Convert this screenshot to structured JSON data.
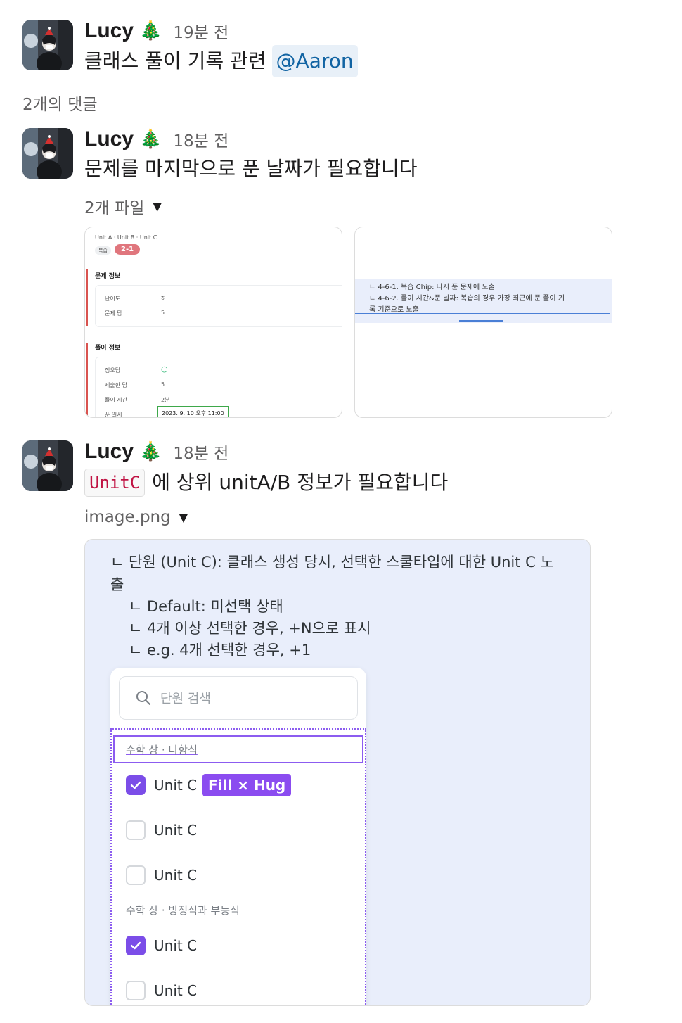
{
  "messages": [
    {
      "author": "Lucy",
      "emoji": "🎄",
      "time": "19분 전",
      "text": "클래스 풀이 기록 관련",
      "mention": "@Aaron"
    },
    {
      "author": "Lucy",
      "emoji": "🎄",
      "time": "18분 전",
      "text": "문제를 마지막으로 푼 날짜가 필요합니다",
      "files_label": "2개 파일"
    },
    {
      "author": "Lucy",
      "emoji": "🎄",
      "time": "18분 전",
      "code": "UnitC",
      "text": "에 상위 unitA/B 정보가 필요합니다",
      "file_name": "image.png"
    }
  ],
  "thread": {
    "replies_label": "2개의 댓글"
  },
  "thumb1": {
    "breadcrumb": "Unit A · Unit B · Unit C",
    "tag": "복습",
    "badge": "2-1",
    "section1": "문제 정보",
    "difficulty_label": "난이도",
    "difficulty_value": "하",
    "answer_label": "문제 답",
    "answer_value": "5",
    "section2": "풀이 정보",
    "correct_label": "정오답",
    "correct_value": "○",
    "submitted_label": "제출한 답",
    "submitted_value": "5",
    "time_label": "풀이 시간",
    "time_value": "2분",
    "date_label": "푼 일시",
    "date_value": "2023. 9. 10 오후 11:00"
  },
  "thumb2": {
    "line1": "ㄴ 4-6-1. 복습 Chip: 다시 푼 문제에 노출",
    "line2": "ㄴ 4-6-2. 풀이 시간&푼 날짜: 복습의 경우 가장 최근에 푼 풀이 기",
    "line3": "록 기준으로 노출"
  },
  "image": {
    "line1": "ㄴ 단원 (Unit C): 클래스 생성 당시, 선택한 스쿨타입에 대한 Unit C 노",
    "line2": "출",
    "line3": "ㄴ Default: 미선택 상태",
    "line4": "ㄴ 4개 이상 선택한 경우, +N으로 표시",
    "line5": "ㄴ e.g. 4개 선택한 경우, +1",
    "search_placeholder": "단원 검색",
    "group1": "수학 상 · 다항식",
    "group2": "수학 상 · 방정식과 부등식",
    "hug_label": "Fill × Hug",
    "items": [
      {
        "label": "Unit C",
        "checked": true
      },
      {
        "label": "Unit C",
        "checked": false
      },
      {
        "label": "Unit C",
        "checked": false
      },
      {
        "label": "Unit C",
        "checked": true
      },
      {
        "label": "Unit C",
        "checked": false
      }
    ]
  },
  "colors": {
    "mention_bg": "#e8f0f8",
    "mention_text": "#1264a3",
    "code_text": "#c01343",
    "check": "#7b4de8",
    "badge": "#e0767d"
  }
}
